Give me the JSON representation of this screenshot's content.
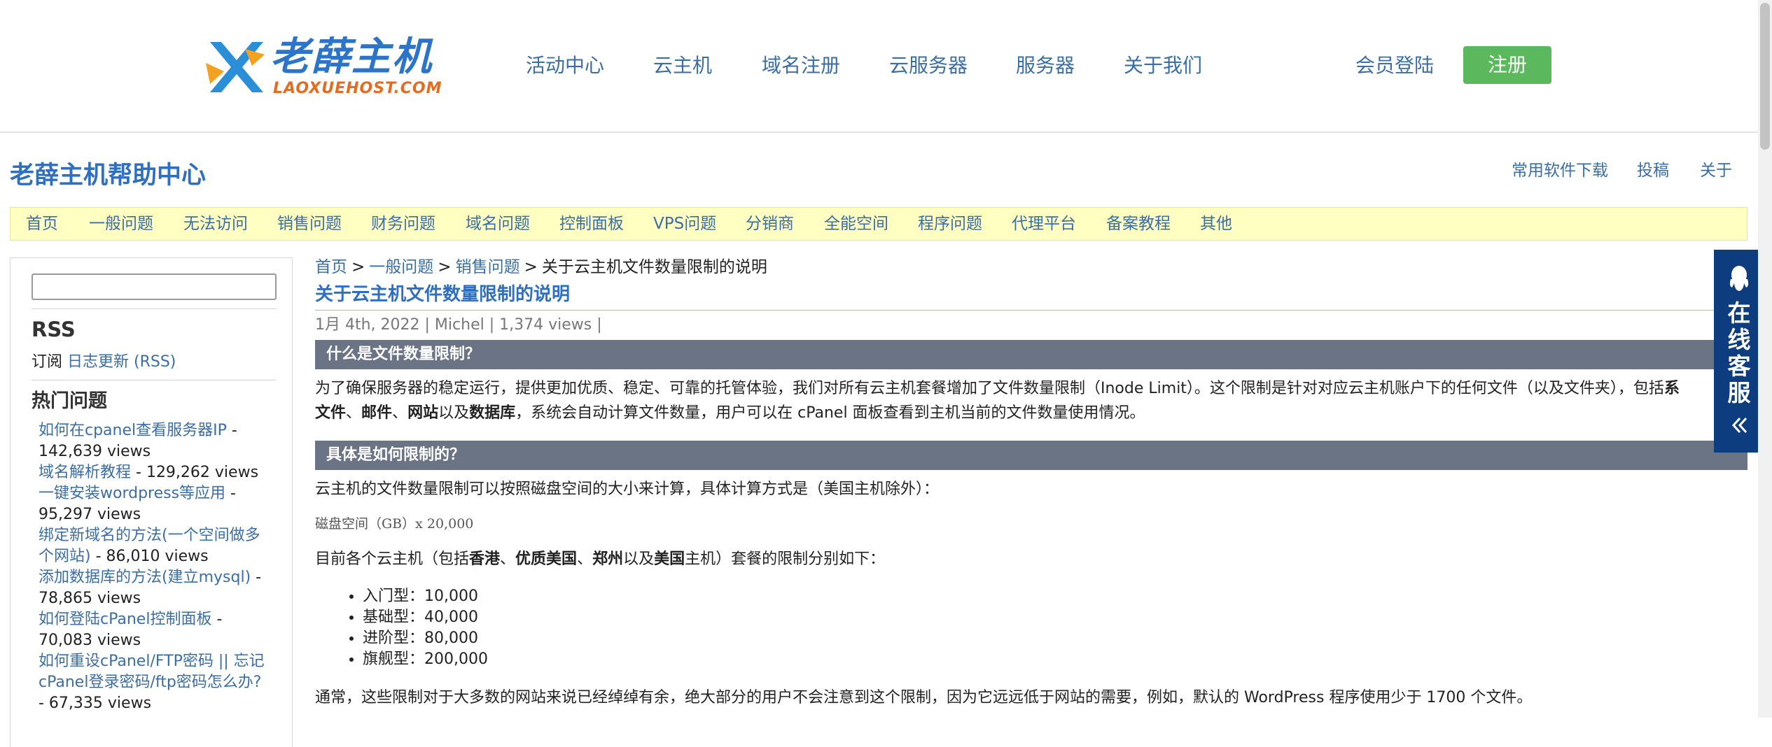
{
  "site_header": {
    "logo_cn": "老薛主机",
    "logo_en": "LAOXUEHOST.COM",
    "nav": [
      "活动中心",
      "云主机",
      "域名注册",
      "云服务器",
      "服务器",
      "关于我们"
    ],
    "login_label": "会员登陆",
    "register_label": "注册"
  },
  "help_header": {
    "title": "老薛主机帮助中心",
    "links": [
      "常用软件下载",
      "投稿",
      "关于"
    ]
  },
  "categories": [
    "首页",
    "一般问题",
    "无法访问",
    "销售问题",
    "财务问题",
    "域名问题",
    "控制面板",
    "VPS问题",
    "分销商",
    "全能空间",
    "程序问题",
    "代理平台",
    "备案教程",
    "其他"
  ],
  "sidebar": {
    "search_value": "",
    "rss_heading": "RSS",
    "rss_prefix": "订阅",
    "rss_link": "日志更新 (RSS)",
    "hot_heading": "热门问题",
    "hot_items": [
      {
        "title": "如何在cpanel查看服务器IP",
        "views": " - 142,639 views"
      },
      {
        "title": "域名解析教程",
        "views": " - 129,262 views"
      },
      {
        "title": "一键安装wordpress等应用",
        "views": " - 95,297 views"
      },
      {
        "title": "绑定新域名的方法(一个空间做多个网站)",
        "views": " - 86,010 views"
      },
      {
        "title": "添加数据库的方法(建立mysql)",
        "views": " - 78,865 views"
      },
      {
        "title": "如何登陆cPanel控制面板",
        "views": " - 70,083 views"
      },
      {
        "title": "如何重设cPanel/FTP密码 || 忘记cPanel登录密码/ftp密码怎么办?",
        "views": " - 67,335 views"
      }
    ]
  },
  "article": {
    "breadcrumb": [
      "首页",
      "一般问题",
      "销售问题"
    ],
    "breadcrumb_sep": ">",
    "breadcrumb_current": "关于云主机文件数量限制的说明",
    "title": "关于云主机文件数量限制的说明",
    "meta": "1月 4th, 2022 | Michel | 1,374 views |",
    "section1_heading": "什么是文件数量限制？",
    "section1_p1": "为了确保服务器的稳定运行，提供更加优质、稳定、可靠的托管体验，我们对所有云主机套餐增加了文件数量限制（Inode Limit）。这个限制是针对对应云主机账户下的任何文件（以及文件夹），包括",
    "section1_p1_bold": "系",
    "section1_p2_b1": "文件",
    "section1_p2_s1": "、",
    "section1_p2_b2": "邮件",
    "section1_p2_s2": "、",
    "section1_p2_b3": "网站",
    "section1_p2_s3": "以及",
    "section1_p2_b4": "数据库",
    "section1_p2_tail": "，系统会自动计算文件数量，用户可以在 cPanel 面板查看到主机当前的文件数量使用情况。",
    "section2_heading": "具体是如何限制的？",
    "section2_p1": "云主机的文件数量限制可以按照磁盘空间的大小来计算，具体计算方式是（美国主机除外）：",
    "formula": "磁盘空间（GB）x 20,000",
    "section2_p2_a": "目前各个云主机（包括",
    "section2_p2_b1": "香港",
    "section2_p2_s1": "、",
    "section2_p2_b2": "优质美国",
    "section2_p2_s2": "、",
    "section2_p2_b3": "郑州",
    "section2_p2_s3": "以及",
    "section2_p2_b4": "美国",
    "section2_p2_tail": "主机）套餐的限制分别如下：",
    "plans": [
      "入门型：10,000",
      "基础型：40,000",
      "进阶型：80,000",
      "旗舰型：200,000"
    ],
    "section2_p3": "通常，这些限制对于大多数的网站来说已经绰绰有余，绝大部分的用户不会注意到这个限制，因为它远远低于网站的需要，例如，默认的 WordPress 程序使用少于 1700 个文件。"
  },
  "chat_widget": {
    "text": [
      "在",
      "线",
      "客",
      "服"
    ],
    "icon": "qq-icon",
    "collapse_icon": "double-chevron-left-icon",
    "bg_color": "#0d3d7e"
  },
  "colors": {
    "link": "#3a6ea5",
    "title_blue": "#2f6fbf",
    "register_green": "#5cb85c",
    "category_bar": "#ffffc2",
    "section_bar": "#6b7484"
  }
}
